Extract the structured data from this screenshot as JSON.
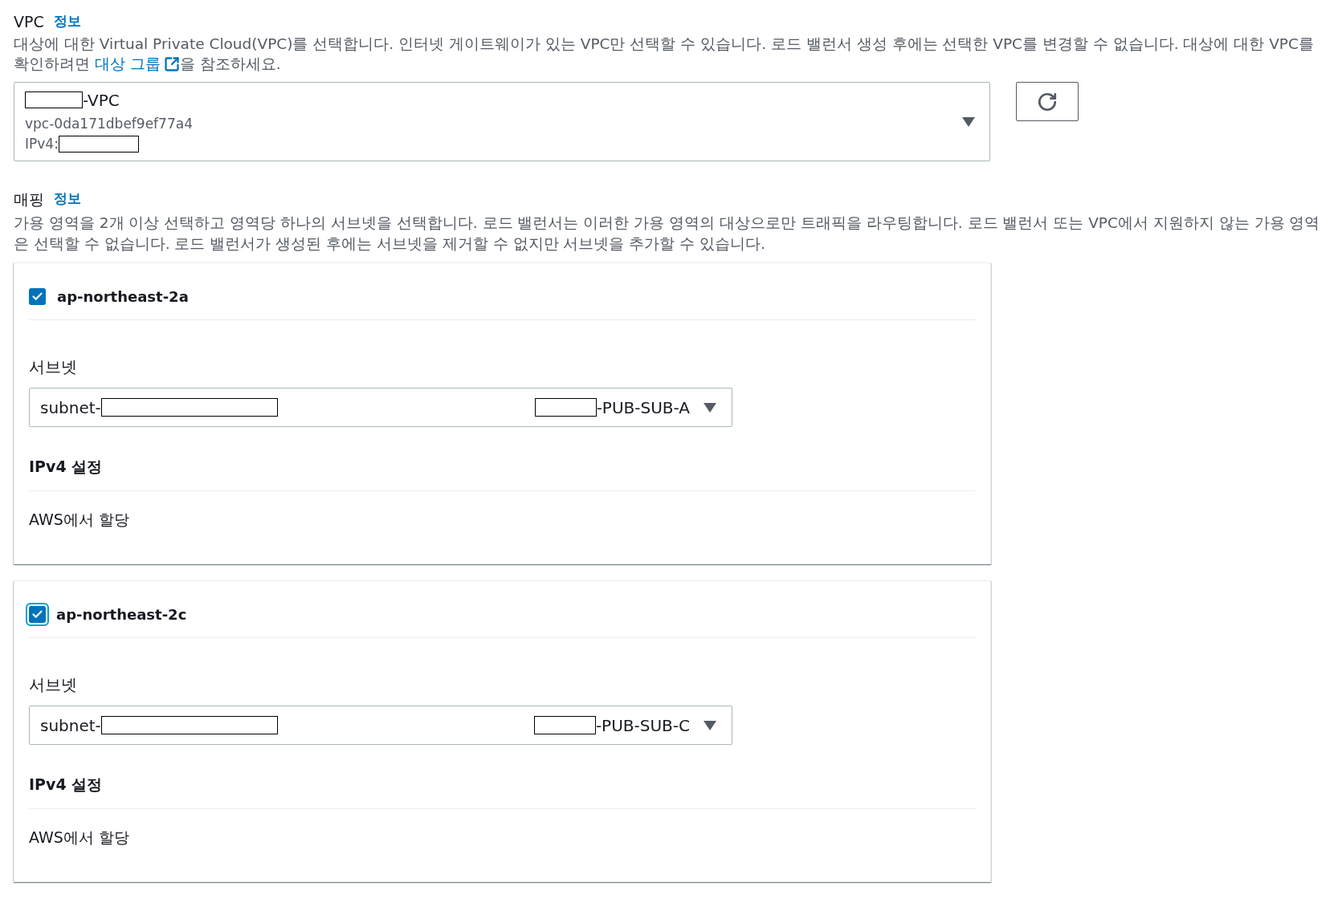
{
  "vpc": {
    "label": "VPC",
    "info_link": "정보",
    "description": "대상에 대한 Virtual Private Cloud(VPC)를 선택합니다. 인터넷 게이트웨이가 있는 VPC만 선택할 수 있습니다. 로드 밸런서 생성 후에는 선택한 VPC를 변경할 수 없습니다. 대상에 대한 VPC를 확인하려면 ",
    "description_link": "대상 그룹",
    "description_after": "을 참조하세요.",
    "select": {
      "name_parts": [
        {
          "kind": "redacted"
        },
        {
          "kind": "text",
          "text": "-VPC"
        }
      ],
      "id": "vpc-0da171dbef9ef77a4",
      "ipv4_parts": [
        {
          "kind": "text",
          "text": "IPv4:"
        },
        {
          "kind": "redacted"
        }
      ]
    }
  },
  "mapping": {
    "label": "매핑",
    "info_link": "정보",
    "description": "가용 영역을 2개 이상 선택하고 영역당 하나의 서브넷을 선택합니다. 로드 밸런서는 이러한 가용 영역의 대상으로만 트래픽을 라우팅합니다. 로드 밸런서 또는 VPC에서 지원하지 않는 가용 영역은 선택할 수 없습니다. 로드 밸런서가 생성된 후에는 서브넷을 제거할 수 없지만 서브넷을 추가할 수 있습니다."
  },
  "zones": [
    {
      "name": "ap-northeast-2a",
      "checked": true,
      "focused": false,
      "subnet_label": "서브넷",
      "subnet": {
        "id_parts": [
          {
            "kind": "text",
            "text": "subnet-"
          },
          {
            "kind": "redacted"
          }
        ],
        "name_parts": [
          {
            "kind": "redacted"
          },
          {
            "kind": "text",
            "text": "-PUB-SUB-A"
          }
        ]
      },
      "ipv4_heading": "IPv4 설정",
      "ipv4_value": "AWS에서 할당"
    },
    {
      "name": "ap-northeast-2c",
      "checked": true,
      "focused": true,
      "subnet_label": "서브넷",
      "subnet": {
        "id_parts": [
          {
            "kind": "text",
            "text": "subnet-"
          },
          {
            "kind": "redacted"
          }
        ],
        "name_parts": [
          {
            "kind": "redacted"
          },
          {
            "kind": "text",
            "text": "-PUB-SUB-C"
          }
        ]
      },
      "ipv4_heading": "IPv4 설정",
      "ipv4_value": "AWS에서 할당"
    }
  ]
}
